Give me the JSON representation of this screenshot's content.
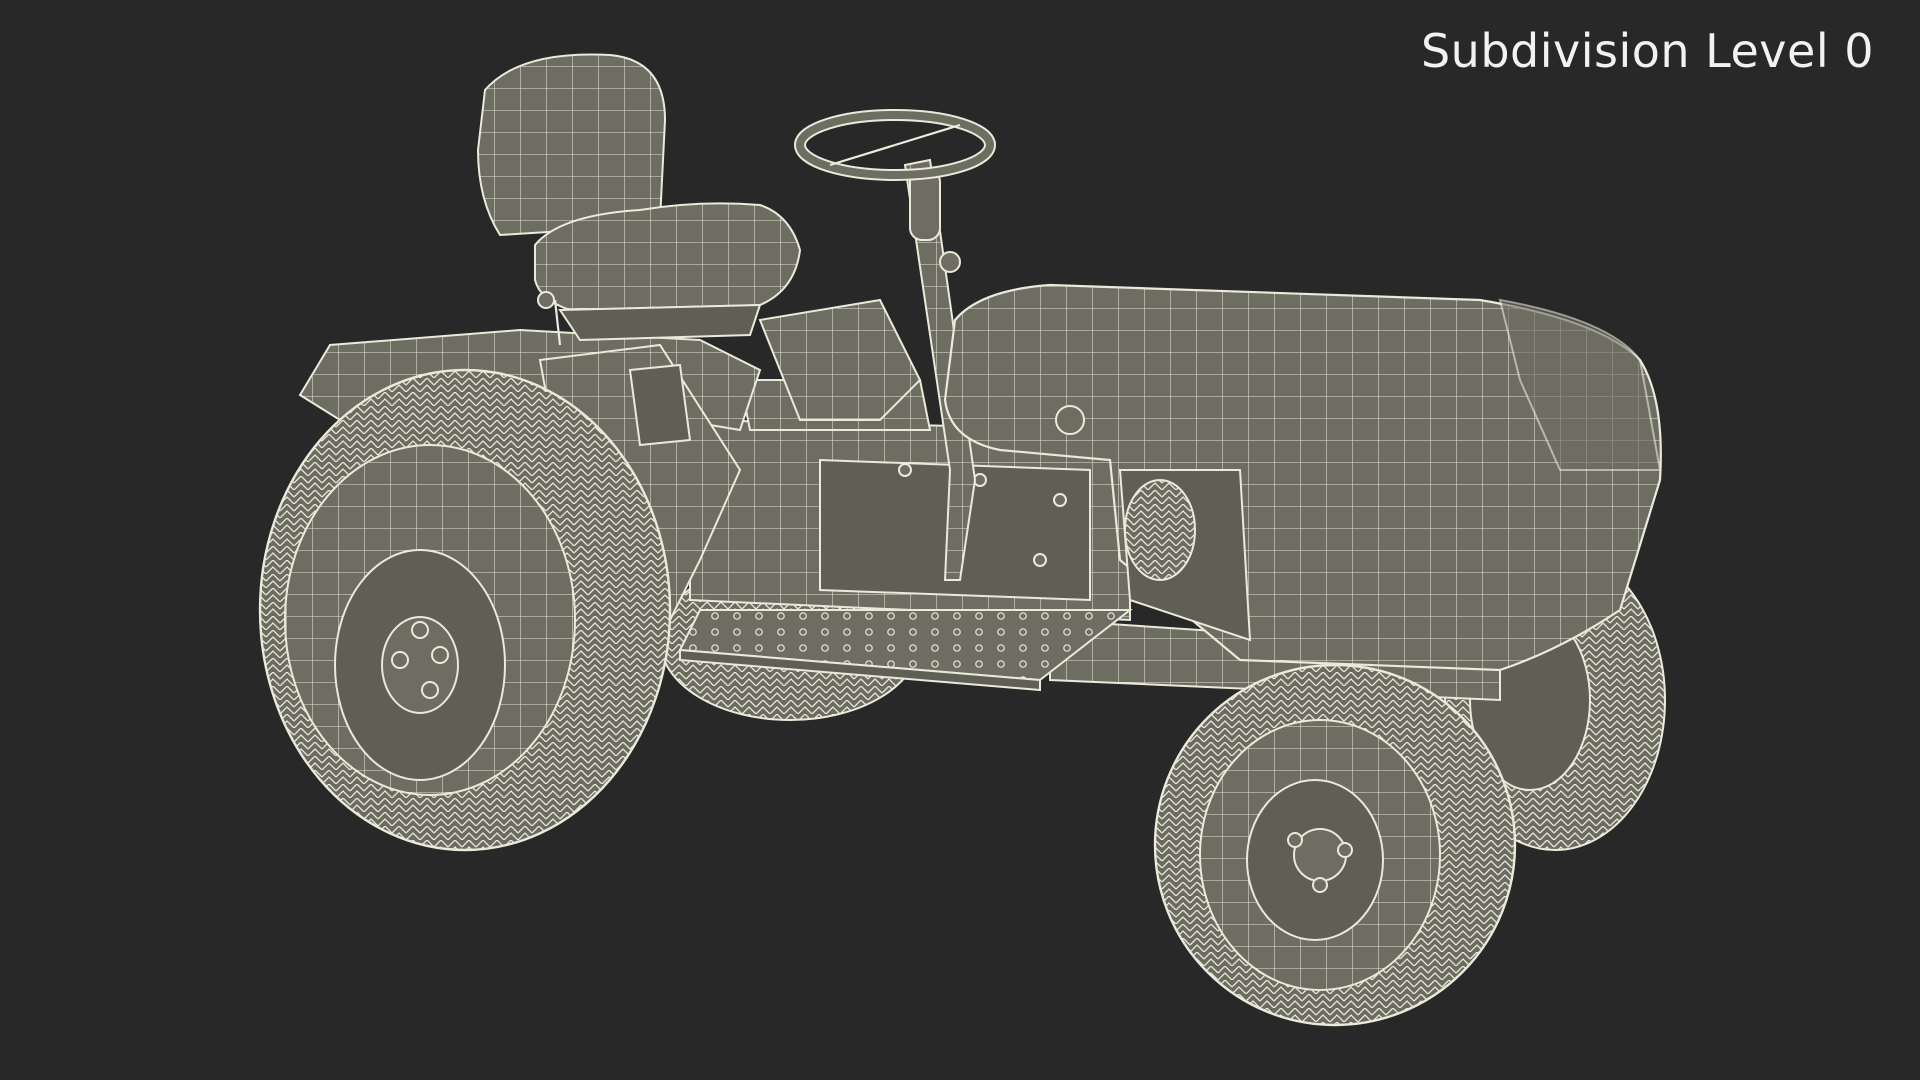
{
  "viewport": {
    "background_color": "#282828",
    "overlay_label": "Subdivision Level 0",
    "overlay_label_color": "#f2f2f2"
  },
  "model": {
    "subject": "lawn tractor wireframe",
    "mesh_fill_color": "#6d6d62",
    "wire_color": "#e9e9dc"
  }
}
